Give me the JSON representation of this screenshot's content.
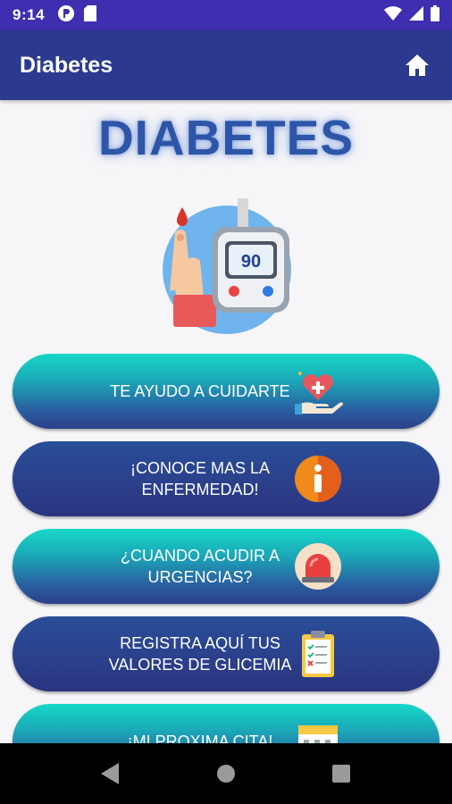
{
  "status": {
    "time": "9:14",
    "icons": [
      "notification-p-icon",
      "sd-card-icon",
      "wifi-icon",
      "signal-icon",
      "battery-icon"
    ]
  },
  "appbar": {
    "title": "Diabetes",
    "home_icon": "home-icon"
  },
  "main": {
    "title": "DIABETES",
    "hero_icon": "glucose-meter-icon",
    "hero_reading": "90",
    "buttons": [
      {
        "label": "TE AYUDO A CUIDARTE",
        "icon": "heart-care-icon"
      },
      {
        "label": "¡CONOCE MAS LA\nENFERMEDAD!",
        "icon": "info-icon"
      },
      {
        "label": "¿CUANDO ACUDIR A\nURGENCIAS?",
        "icon": "emergency-siren-icon"
      },
      {
        "label": "REGISTRA AQUÍ TUS\nVALORES DE GLICEMIA",
        "icon": "clipboard-checklist-icon"
      },
      {
        "label": "¡MI PROXIMA CITA!",
        "icon": "calendar-icon"
      }
    ]
  },
  "navbar": {
    "icons": [
      "back-icon",
      "home-circle-icon",
      "recents-icon"
    ]
  },
  "colors": {
    "status_bar": "#3e2fb0",
    "app_bar": "#2b3a8e",
    "title": "#2d56a8",
    "button_teal": "#17d7c7",
    "button_navy": "#2b3f8a"
  }
}
